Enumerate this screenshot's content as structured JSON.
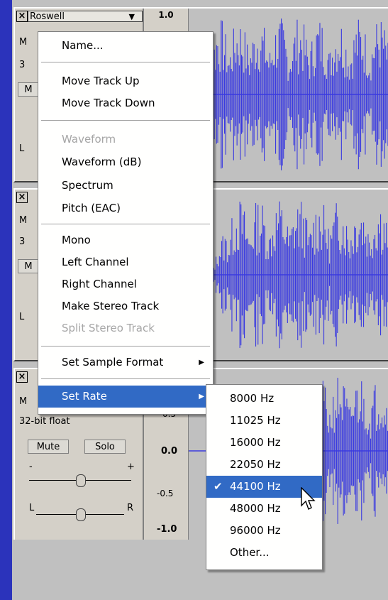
{
  "tracks": [
    {
      "name": "Roswell",
      "scale_top": "1.0",
      "info_line1": "M",
      "info_line2": "3",
      "btn_partial": "M",
      "left_label": "L"
    },
    {
      "info_line1": "M",
      "info_line2": "3",
      "btn_partial": "M",
      "left_label": "L"
    },
    {
      "info_line1": "M",
      "info_line2": "32-bit float",
      "mute_label": "Mute",
      "solo_label": "Solo",
      "gain_minus": "-",
      "gain_plus": "+",
      "pan_left": "L",
      "pan_right": "R",
      "scale_ticks": [
        "0.5",
        "0.0",
        "-0.5",
        "-1.0"
      ]
    }
  ],
  "track_menu": {
    "items": [
      {
        "label": "Name...",
        "disabled": false
      },
      {
        "label": "Move Track Up",
        "disabled": false
      },
      {
        "label": "Move Track Down",
        "disabled": false
      },
      {
        "label": "Waveform",
        "disabled": true
      },
      {
        "label": "Waveform (dB)",
        "disabled": false
      },
      {
        "label": "Spectrum",
        "disabled": false
      },
      {
        "label": "Pitch (EAC)",
        "disabled": false
      },
      {
        "label": "Mono",
        "disabled": false
      },
      {
        "label": "Left Channel",
        "disabled": false
      },
      {
        "label": "Right Channel",
        "disabled": false
      },
      {
        "label": "Make Stereo Track",
        "disabled": false
      },
      {
        "label": "Split Stereo Track",
        "disabled": true
      },
      {
        "label": "Set Sample Format",
        "disabled": false,
        "submenu": true
      },
      {
        "label": "Set Rate",
        "disabled": false,
        "submenu": true,
        "highlighted": true
      }
    ]
  },
  "rate_menu": {
    "items": [
      "8000 Hz",
      "11025 Hz",
      "16000 Hz",
      "22050 Hz",
      "44100 Hz",
      "48000 Hz",
      "96000 Hz",
      "Other..."
    ],
    "selected": "44100 Hz"
  },
  "icons": {
    "close": "close-icon",
    "dropdown": "chevron-down-icon",
    "submenu": "submenu-arrow-icon",
    "check": "check-icon",
    "cursor": "mouse-pointer-icon"
  },
  "colors": {
    "background": "#2b33bb",
    "waveform": "#3a3ae0",
    "highlight": "#316ac5"
  }
}
